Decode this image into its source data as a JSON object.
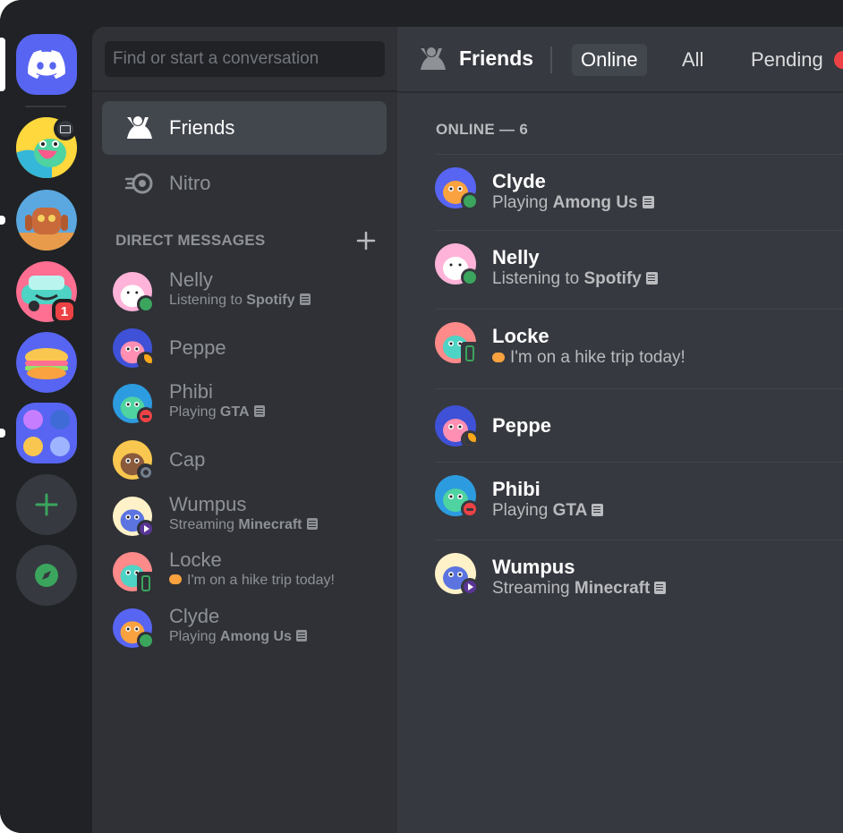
{
  "search": {
    "placeholder": "Find or start a conversation"
  },
  "nav": {
    "friends": "Friends",
    "nitro": "Nitro"
  },
  "dm_header": "DIRECT MESSAGES",
  "servers": {
    "badge": "1"
  },
  "topbar": {
    "title": "Friends",
    "tabs": [
      "Online",
      "All",
      "Pending"
    ],
    "active_tab": "Online"
  },
  "online_header": "ONLINE — 6",
  "direct_messages": [
    {
      "name": "Nelly",
      "prefix": "Listening to ",
      "activity": "Spotify",
      "status": "online"
    },
    {
      "name": "Peppe",
      "prefix": "",
      "activity": "",
      "status": "idle"
    },
    {
      "name": "Phibi",
      "prefix": "Playing ",
      "activity": "GTA",
      "status": "dnd"
    },
    {
      "name": "Cap",
      "prefix": "",
      "activity": "",
      "status": "offline"
    },
    {
      "name": "Wumpus",
      "prefix": "Streaming ",
      "activity": "Minecraft",
      "status": "streaming"
    },
    {
      "name": "Locke",
      "custom": "I'm on a hike trip today!",
      "status": "mobile"
    },
    {
      "name": "Clyde",
      "prefix": "Playing ",
      "activity": "Among Us",
      "status": "online"
    }
  ],
  "friends_online": [
    {
      "name": "Clyde",
      "prefix": "Playing ",
      "activity": "Among Us",
      "status": "online"
    },
    {
      "name": "Nelly",
      "prefix": "Listening to ",
      "activity": "Spotify",
      "status": "online"
    },
    {
      "name": "Locke",
      "custom": "I'm on a hike trip today!",
      "status": "mobile"
    },
    {
      "name": "Peppe",
      "prefix": "",
      "activity": "",
      "status": "idle"
    },
    {
      "name": "Phibi",
      "prefix": "Playing ",
      "activity": "GTA",
      "status": "dnd"
    },
    {
      "name": "Wumpus",
      "prefix": "Streaming ",
      "activity": "Minecraft",
      "status": "streaming"
    }
  ],
  "colors": {
    "blurple": "#5865f2",
    "online": "#3ba55d",
    "idle": "#faa81a",
    "dnd": "#ed4245",
    "streaming": "#593695",
    "offline": "#747f8d"
  }
}
